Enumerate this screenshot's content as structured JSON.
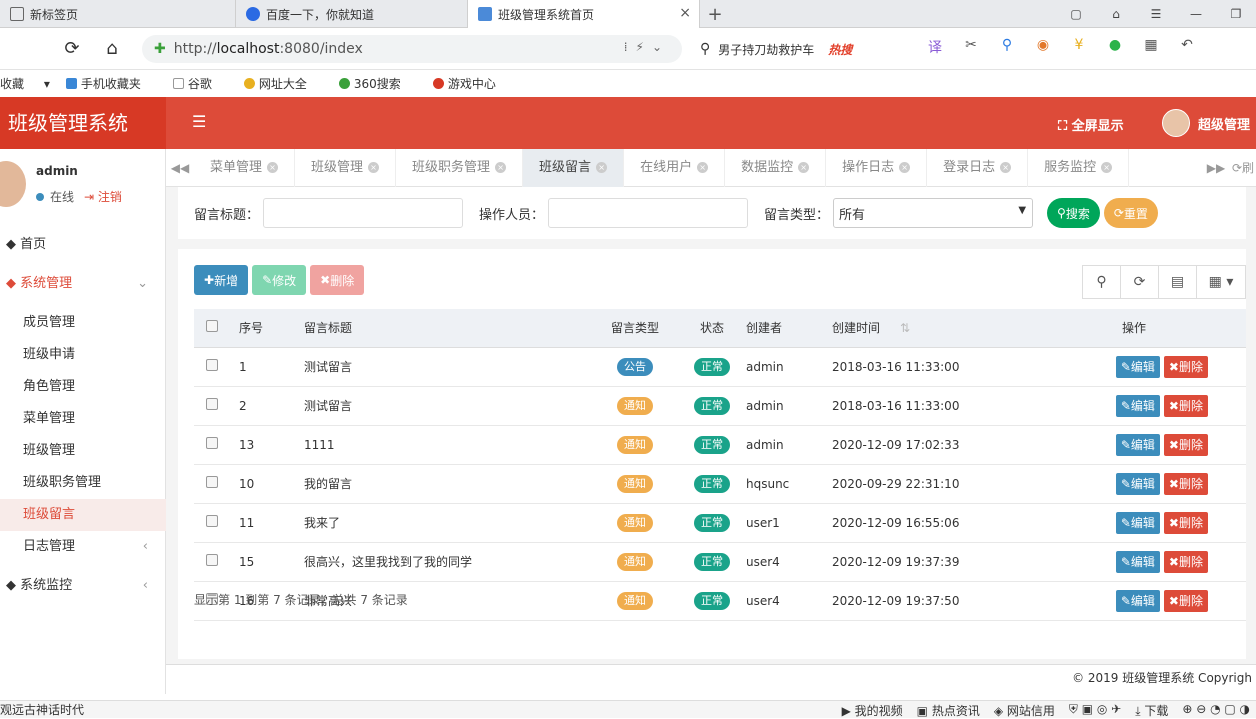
{
  "browser": {
    "tabs": [
      {
        "title": "新标签页"
      },
      {
        "title": "百度一下，你就知道"
      },
      {
        "title": "班级管理系统首页"
      }
    ],
    "url_prefix": "http://",
    "url_host": "localhost",
    "url_rest": ":8080/index",
    "search_text": "男子持刀劫救护车",
    "search_hot": "热搜",
    "bookmarks": [
      "收藏",
      "手机收藏夹",
      "谷歌",
      "网址大全",
      "360搜索",
      "游戏中心"
    ]
  },
  "header": {
    "app_title": "班级管理系统",
    "fullscreen": "全屏显示",
    "user": "超级管理"
  },
  "sidebar": {
    "username": "admin",
    "status": "在线",
    "logout": "注销",
    "home": "首页",
    "group1": "系统管理",
    "items": [
      "成员管理",
      "班级申请",
      "角色管理",
      "菜单管理",
      "班级管理",
      "班级职务管理",
      "班级留言",
      "日志管理"
    ],
    "group2": "系统监控"
  },
  "content_tabs": [
    "菜单管理",
    "班级管理",
    "班级职务管理",
    "班级留言",
    "在线用户",
    "数据监控",
    "操作日志",
    "登录日志",
    "服务监控"
  ],
  "refresh_label": "刷",
  "filter": {
    "title_label": "留言标题：",
    "operator_label": "操作人员：",
    "type_label": "留言类型：",
    "type_value": "所有",
    "search_btn": "搜索",
    "reset_btn": "重置"
  },
  "toolbar": {
    "add": "新增",
    "edit": "修改",
    "delete": "删除"
  },
  "table": {
    "headers": [
      "序号",
      "留言标题",
      "留言类型",
      "状态",
      "创建者",
      "创建时间",
      "操作"
    ],
    "rows": [
      {
        "id": "1",
        "title": "测试留言",
        "type": "公告",
        "status": "正常",
        "creator": "admin",
        "time": "2018-03-16 11:33:00"
      },
      {
        "id": "2",
        "title": "测试留言",
        "type": "通知",
        "status": "正常",
        "creator": "admin",
        "time": "2018-03-16 11:33:00"
      },
      {
        "id": "13",
        "title": "1111",
        "type": "通知",
        "status": "正常",
        "creator": "admin",
        "time": "2020-12-09 17:02:33"
      },
      {
        "id": "10",
        "title": "我的留言",
        "type": "通知",
        "status": "正常",
        "creator": "hqsunc",
        "time": "2020-09-29 22:31:10"
      },
      {
        "id": "11",
        "title": "我来了",
        "type": "通知",
        "status": "正常",
        "creator": "user1",
        "time": "2020-12-09 16:55:06"
      },
      {
        "id": "15",
        "title": "很高兴，这里我找到了我的同学",
        "type": "通知",
        "status": "正常",
        "creator": "user4",
        "time": "2020-12-09 19:37:39"
      },
      {
        "id": "16",
        "title": "非常高兴",
        "type": "通知",
        "status": "正常",
        "creator": "user4",
        "time": "2020-12-09 19:37:50"
      }
    ],
    "edit_label": "编辑",
    "delete_label": "删除"
  },
  "page_info": "显示第 1 到第 7 条记录，总共 7 条记录",
  "footer": "© 2019 班级管理系统 Copyrigh",
  "statusbar": {
    "left": "观远古神话时代",
    "right": [
      "我的视频",
      "热点资讯",
      "网站信用",
      "下载"
    ]
  }
}
